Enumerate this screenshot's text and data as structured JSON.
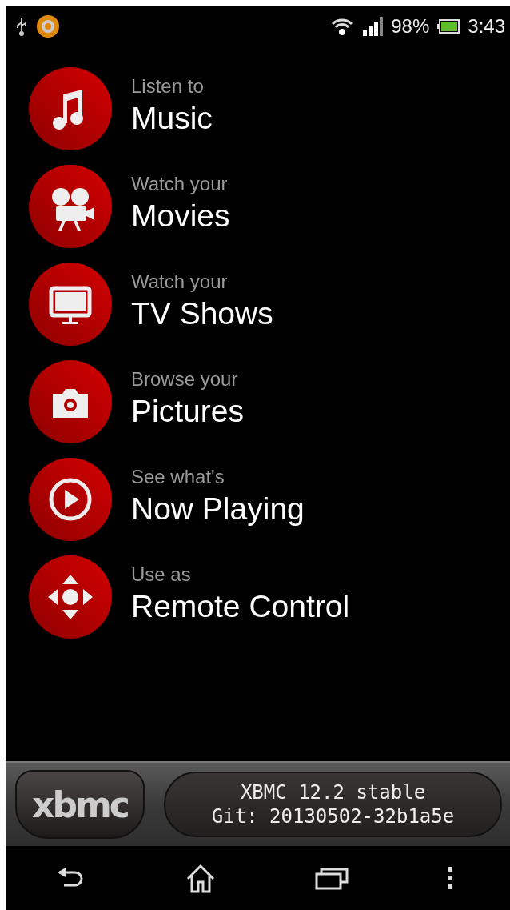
{
  "status_bar": {
    "battery_percent": "98%",
    "time": "3:43"
  },
  "menu": [
    {
      "kind": "music",
      "caption": "Listen to",
      "title": "Music"
    },
    {
      "kind": "movies",
      "caption": "Watch your",
      "title": "Movies"
    },
    {
      "kind": "tv",
      "caption": "Watch your",
      "title": "TV Shows"
    },
    {
      "kind": "pictures",
      "caption": "Browse your",
      "title": "Pictures"
    },
    {
      "kind": "playing",
      "caption": "See what's",
      "title": "Now Playing"
    },
    {
      "kind": "remote",
      "caption": "Use as",
      "title": "Remote Control"
    }
  ],
  "footer": {
    "logo": "xbmc",
    "version": "XBMC 12.2 stable",
    "build": "Git: 20130502-32b1a5e"
  }
}
